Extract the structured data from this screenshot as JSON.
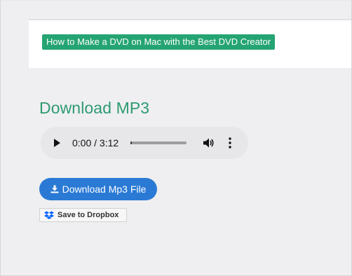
{
  "header": {
    "title_badge": "How to Make a DVD on Mac with the Best DVD Creator"
  },
  "main": {
    "heading": "Download MP3",
    "audio_player": {
      "time_display": "0:00 / 3:12",
      "progress": 0,
      "icons": {
        "play": "play-icon",
        "volume": "volume-icon",
        "more": "more-options-icon"
      }
    },
    "download_button": {
      "label": "Download Mp3 File",
      "icon": "download-icon"
    },
    "dropbox_button": {
      "label": "Save to Dropbox",
      "icon": "dropbox-icon"
    }
  },
  "colors": {
    "page_background": "#efeff1",
    "badge_background": "#25a473",
    "heading_color": "#2e9a70",
    "download_button_background": "#2a7ad5",
    "dropbox_blue": "#0061fe"
  }
}
